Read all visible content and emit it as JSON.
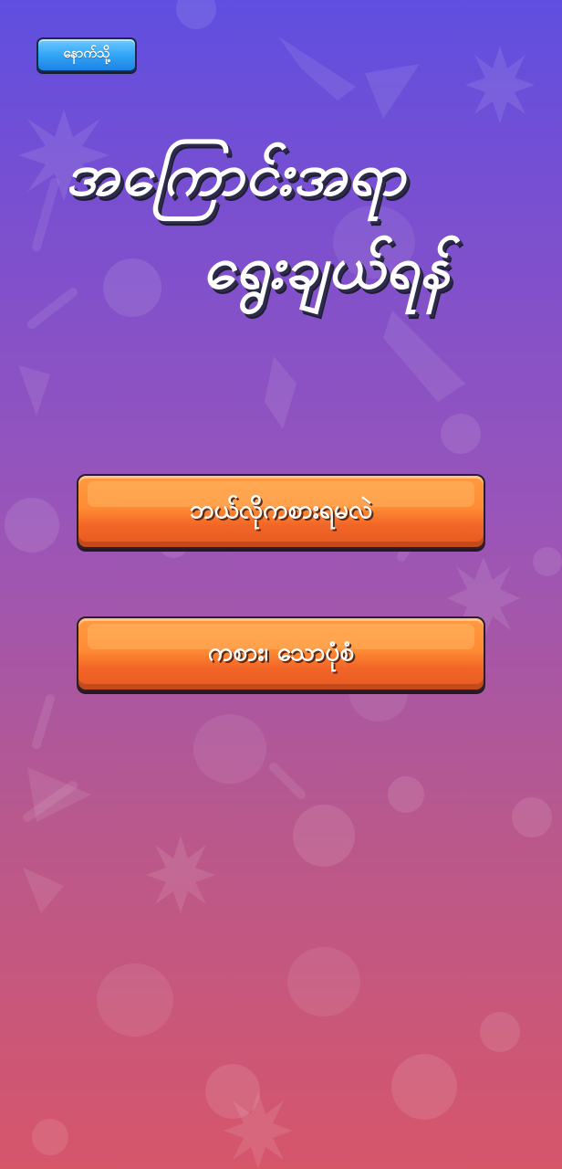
{
  "header": {
    "back_label": "နောက်သို့"
  },
  "title": {
    "line1": "အကြောင်းအရာ",
    "line2": "ရွေးချယ်ရန်"
  },
  "menu": {
    "buttons": [
      {
        "label": "ဘယ်လိုကစားရမလဲ"
      },
      {
        "label": "ကစား၊ သောပုံစံ"
      }
    ]
  },
  "theme": {
    "gradient_top": "#5f4fe0",
    "gradient_bottom": "#d6566a",
    "button_orange": "#ff8c34",
    "back_button_blue": "#35a7f6"
  },
  "icons": {
    "back_button_icon": "back-arrow",
    "background": [
      "ninja-star-icon",
      "devil-face-icon",
      "rocket-icon",
      "kunai-icon",
      "circle-icon"
    ]
  }
}
